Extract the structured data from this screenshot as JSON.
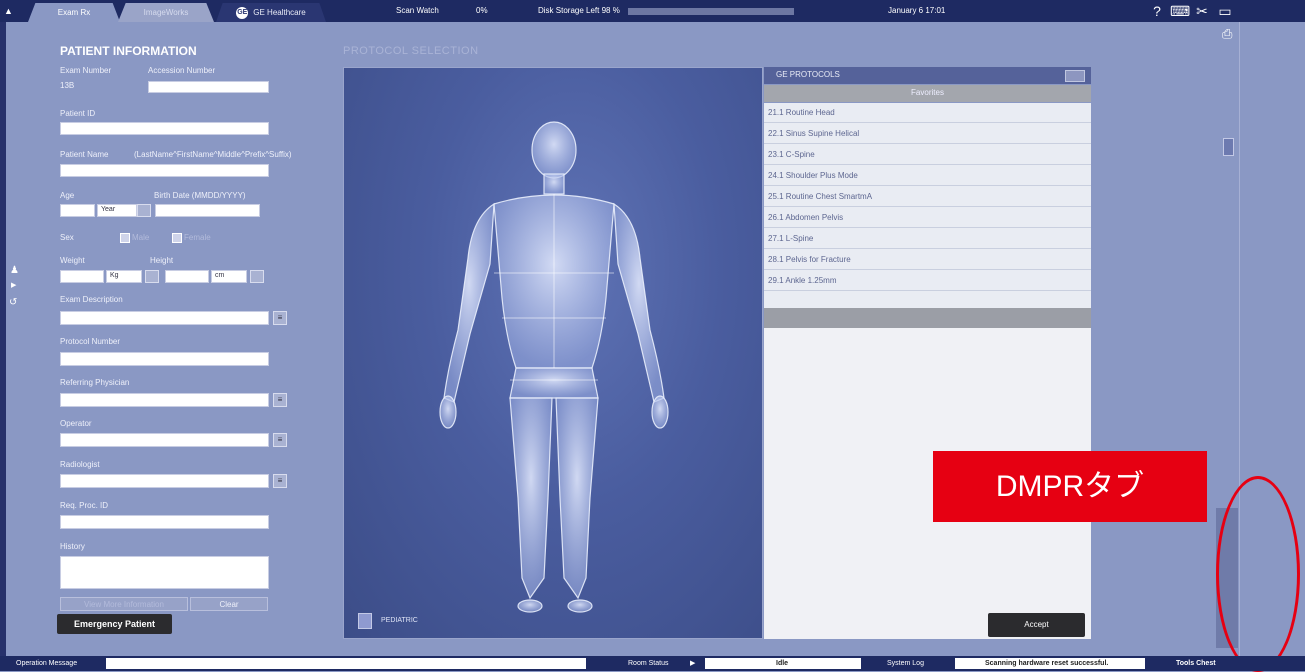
{
  "topbar": {
    "tab_exam": "Exam Rx",
    "tab_image": "ImageWorks",
    "tab_ge": "GE Healthcare",
    "scan_watch": "Scan Watch",
    "scan_pct": "0%",
    "disk_storage": "Disk Storage Left 98 %",
    "date": "January 6 17:01"
  },
  "patient": {
    "title": "PATIENT INFORMATION",
    "exam_number_label": "Exam Number",
    "accession_number_label": "Accession Number",
    "exam_number_value": "13B",
    "patient_id_label": "Patient ID",
    "patient_name_label": "Patient Name",
    "name_format_hint": "(LastName^FirstName^Middle^Prefix^Suffix)",
    "age_label": "Age",
    "birth_date_label": "Birth Date (MMDD/YYYY)",
    "age_unit": "Year",
    "sex_label": "Sex",
    "male": "Male",
    "female": "Female",
    "weight_label": "Weight",
    "height_label": "Height",
    "weight_unit": "Kg",
    "height_unit": "cm",
    "exam_description_label": "Exam Description",
    "protocol_number_label": "Protocol Number",
    "referring_physician_label": "Referring Physician",
    "operator_label": "Operator",
    "radiologist_label": "Radiologist",
    "req_proc_id_label": "Req. Proc. ID",
    "history_label": "History",
    "view_more": "View More Information",
    "clear": "Clear",
    "emergency": "Emergency Patient"
  },
  "protocol": {
    "title": "PROTOCOL SELECTION",
    "ge_protocols": "GE PROTOCOLS",
    "favorites": "Favorites",
    "items": [
      "21.1 Routine Head",
      "22.1 Sinus Supine Helical",
      "23.1 C-Spine",
      "24.1 Shoulder Plus Mode",
      "25.1 Routine Chest SmartmA",
      "26.1 Abdomen Pelvis",
      "27.1 L-Spine",
      "28.1 Pelvis for Fracture",
      "29.1 Ankle 1.25mm"
    ],
    "pediatric": "PEDIATRIC",
    "accept": "Accept"
  },
  "annotation": {
    "dmpr_label": "DMPRタブ"
  },
  "bottombar": {
    "operation_message": "Operation Message",
    "room_status": "Room Status",
    "idle": "Idle",
    "system_log": "System Log",
    "scanning_msg": "Scanning hardware reset successful.",
    "tools_chest": "Tools Chest"
  },
  "colors": {
    "topbar": "#1e2a62",
    "background": "#8a98c4",
    "annotation_red": "#e60012"
  }
}
